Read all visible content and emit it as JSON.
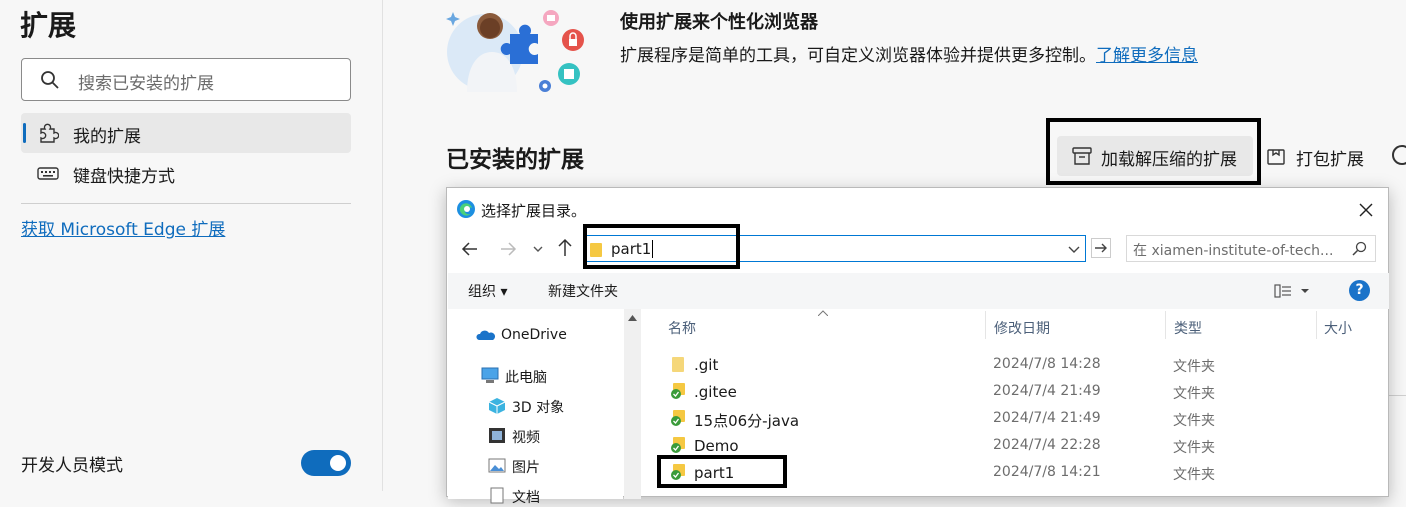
{
  "sidebar": {
    "title": "扩展",
    "search_placeholder": "搜索已安装的扩展",
    "items": [
      {
        "label": "我的扩展",
        "icon": "puzzle-icon"
      },
      {
        "label": "键盘快捷方式",
        "icon": "keyboard-icon"
      }
    ],
    "store_link": "获取 Microsoft Edge 扩展",
    "dev_mode_label": "开发人员模式",
    "dev_mode_enabled": true
  },
  "hero": {
    "title": "使用扩展来个性化浏览器",
    "description": "扩展程序是简单的工具，可自定义浏览器体验并提供更多控制。",
    "link": "了解更多信息"
  },
  "installed": {
    "title": "已安装的扩展",
    "load_unpacked": "加载解压缩的扩展",
    "pack": "打包扩展"
  },
  "dialog": {
    "title": "选择扩展目录。",
    "address_value": "part1",
    "search_placeholder": "在 xiamen-institute-of-tech...",
    "organize": "组织 ▾",
    "new_folder": "新建文件夹",
    "help": "?",
    "nav_tree": [
      {
        "label": "OneDrive",
        "icon": "onedrive-icon"
      },
      {
        "label": "此电脑",
        "icon": "computer-icon"
      },
      {
        "label": "3D 对象",
        "icon": "3d-objects-icon"
      },
      {
        "label": "视频",
        "icon": "video-icon"
      },
      {
        "label": "图片",
        "icon": "pictures-icon"
      },
      {
        "label": "文档",
        "icon": "documents-icon"
      }
    ],
    "columns": [
      "名称",
      "修改日期",
      "类型",
      "大小"
    ],
    "files": [
      {
        "name": ".git",
        "date": "2024/7/8 14:28",
        "type": "文件夹",
        "icon": "folder-icon"
      },
      {
        "name": ".gitee",
        "date": "2024/7/4 21:49",
        "type": "文件夹",
        "icon": "folder-synced-icon"
      },
      {
        "name": "15点06分-java",
        "date": "2024/7/4 21:49",
        "type": "文件夹",
        "icon": "folder-synced-icon"
      },
      {
        "name": "Demo",
        "date": "2024/7/4 22:28",
        "type": "文件夹",
        "icon": "folder-synced-icon"
      },
      {
        "name": "part1",
        "date": "2024/7/8 14:21",
        "type": "文件夹",
        "icon": "folder-synced-icon"
      }
    ]
  },
  "colors": {
    "accent": "#0f6cbd",
    "folder": "#f5c842",
    "sync_green": "#3a9b3a"
  }
}
